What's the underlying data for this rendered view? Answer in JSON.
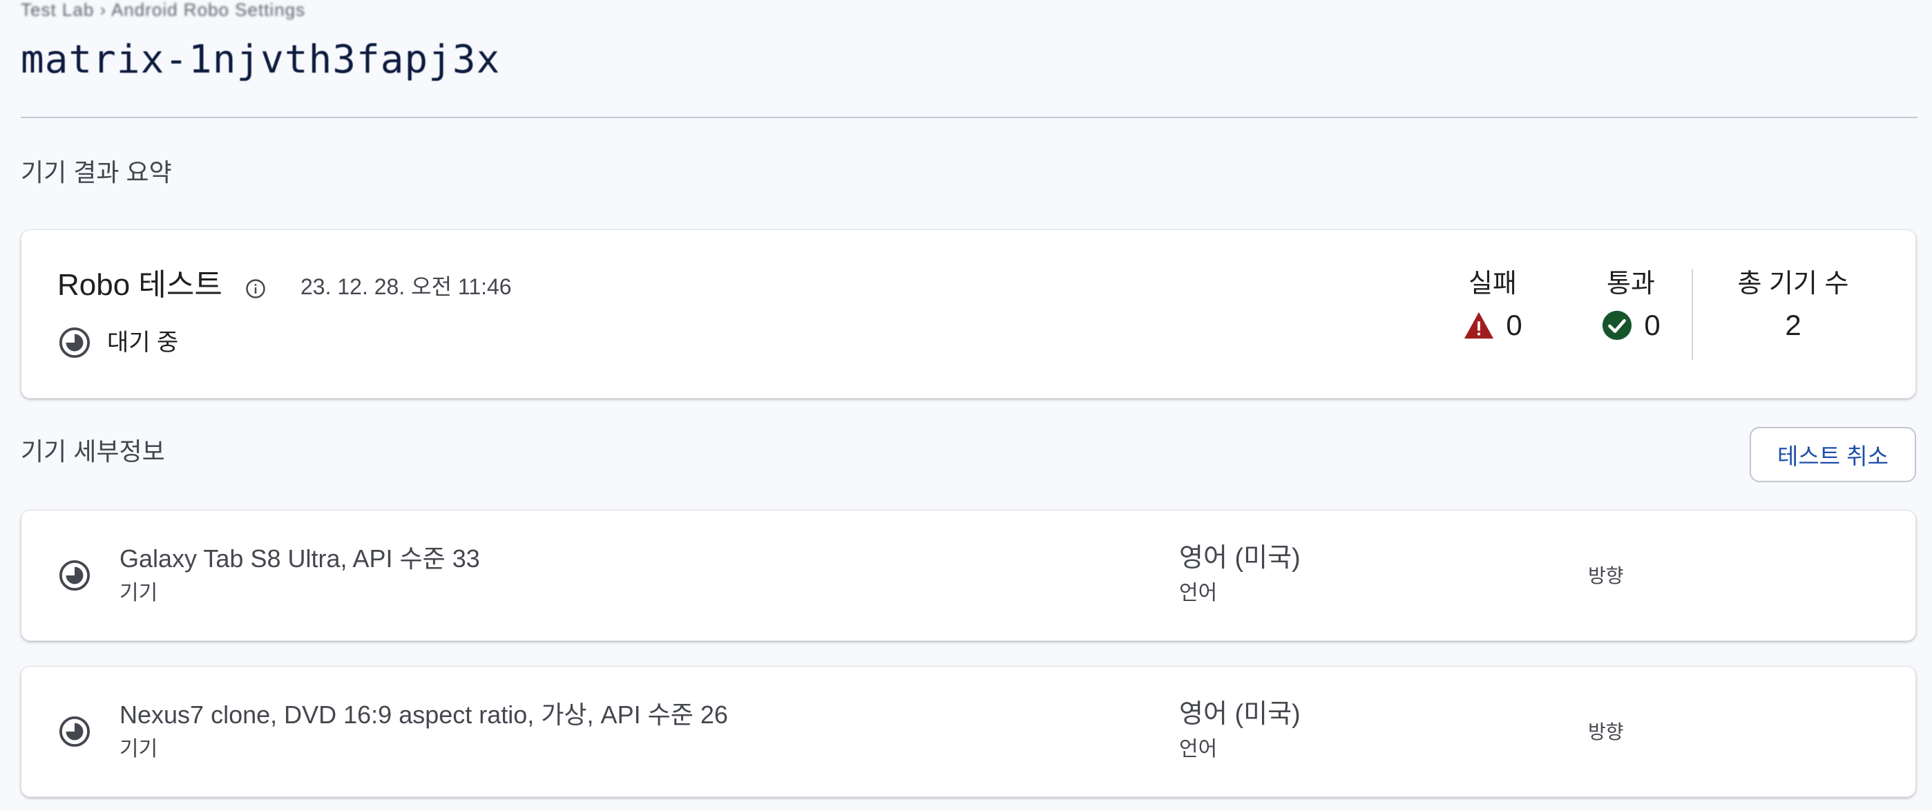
{
  "header": {
    "breadcrumb": "Test Lab › Android Robo Settings",
    "title": "matrix-1njvth3fapj3x"
  },
  "summary": {
    "section_heading": "기기 결과 요약",
    "card": {
      "title": "Robo 테스트",
      "info_icon": "info-icon",
      "timestamp": "23. 12. 28. 오전 11:46",
      "status_icon": "pending-clock-icon",
      "status_text": "대기 중",
      "metrics": {
        "fail": {
          "label": "실패",
          "icon": "warning-triangle-icon",
          "value": "0",
          "color": "#a11d1d"
        },
        "pass": {
          "label": "통과",
          "icon": "check-circle-icon",
          "value": "0",
          "color": "#16552b"
        },
        "total": {
          "label": "총 기기 수",
          "value": "2"
        }
      }
    }
  },
  "details": {
    "section_heading": "기기 세부정보",
    "cancel_button": "테스트 취소",
    "devices": [
      {
        "status_icon": "pending-clock-icon",
        "name": "Galaxy Tab S8 Ultra, API 수준 33",
        "name_label": "기기",
        "language": "영어 (미국)",
        "language_label": "언어",
        "orientation_label": "방향"
      },
      {
        "status_icon": "pending-clock-icon",
        "name": "Nexus7 clone, DVD 16:9 aspect ratio, 가상, API 수준 26",
        "name_label": "기기",
        "language": "영어 (미국)",
        "language_label": "언어",
        "orientation_label": "방향"
      }
    ]
  },
  "colors": {
    "background": "#f8f9fd",
    "accent": "#1d4ea8",
    "fail": "#a11d1d",
    "pass": "#16552b",
    "pending_icon": "#44474e"
  }
}
